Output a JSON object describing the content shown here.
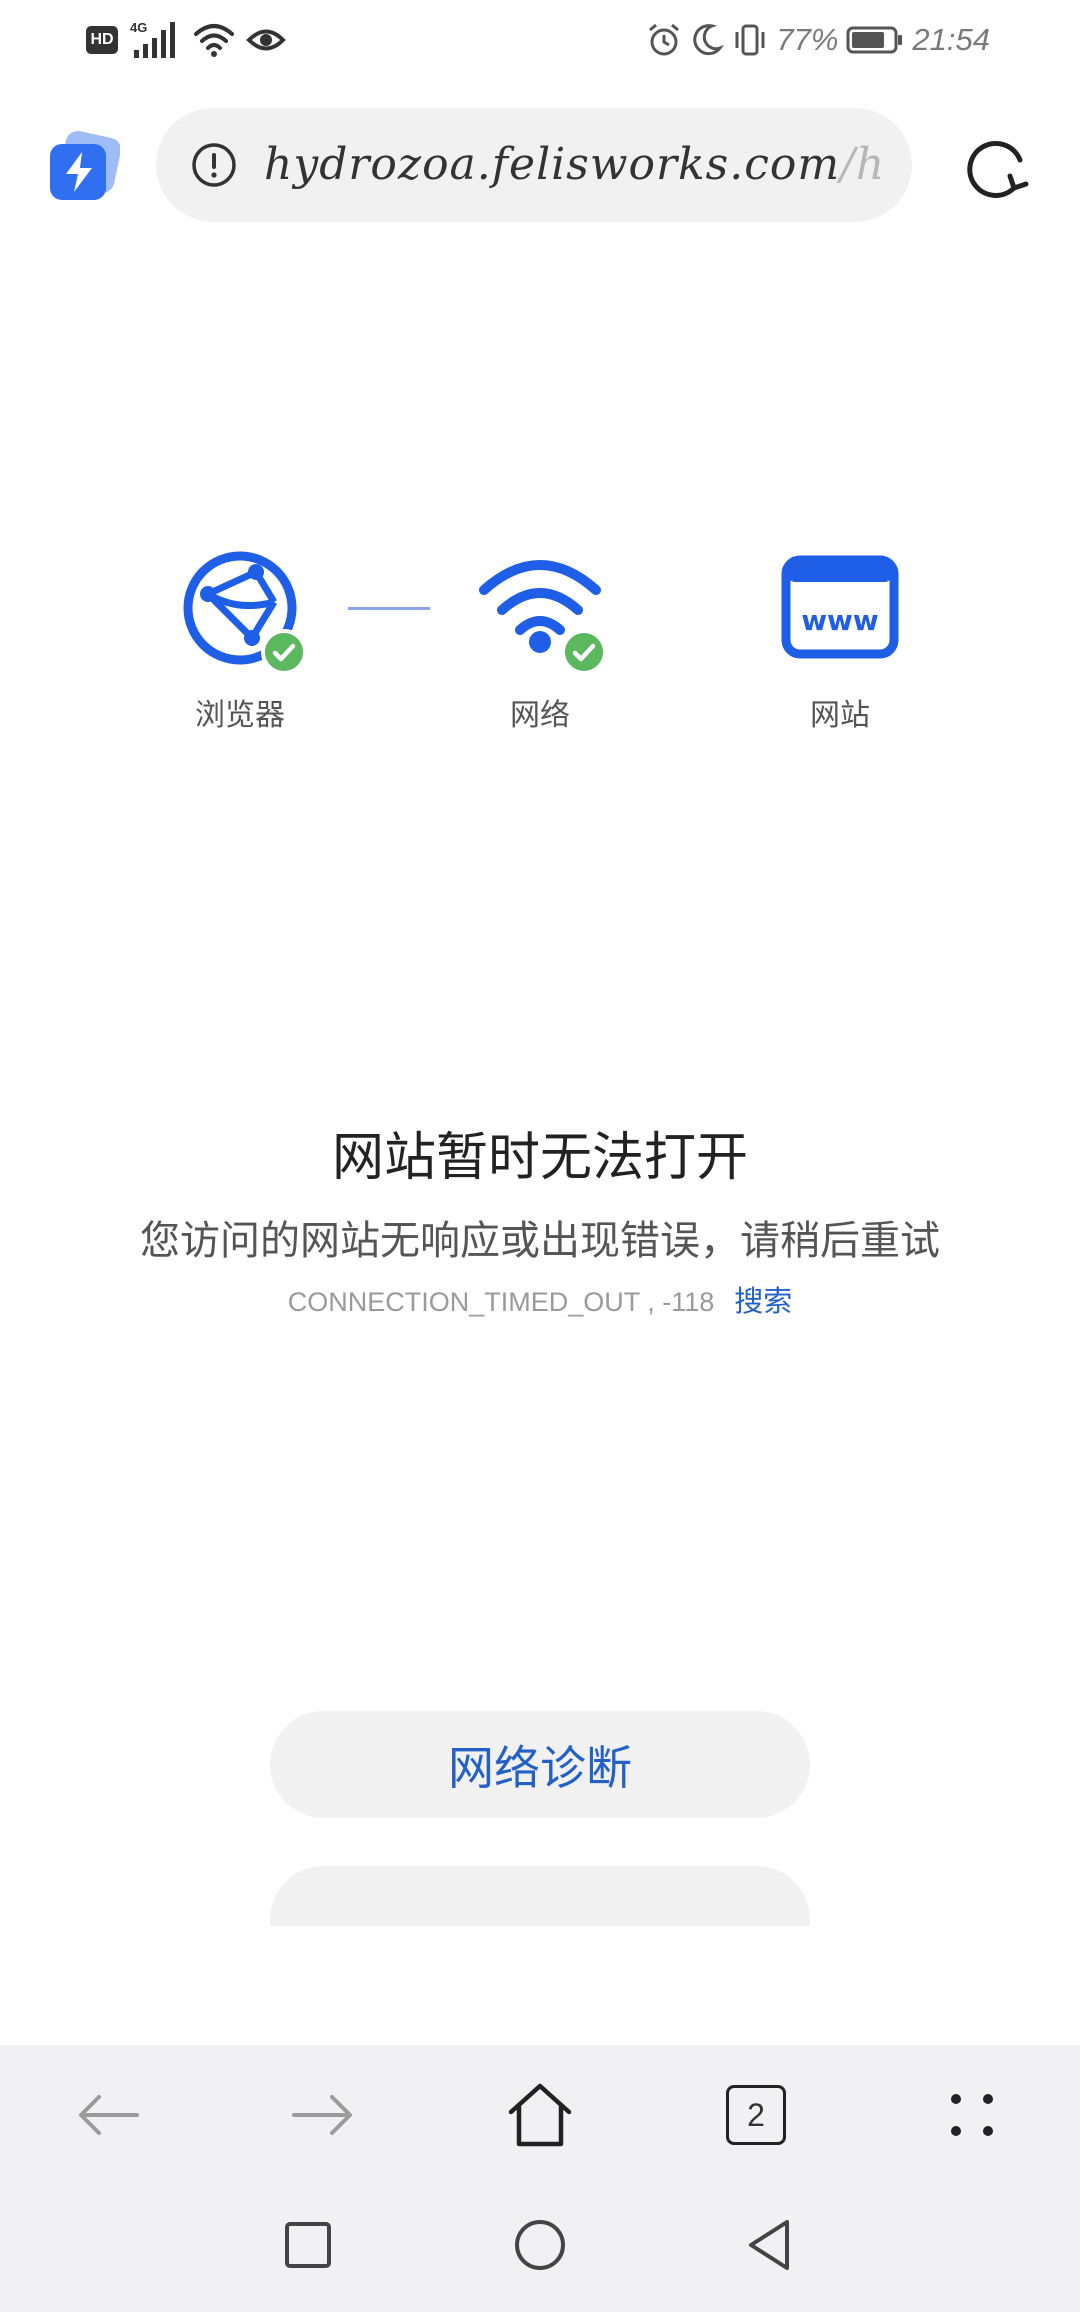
{
  "status_bar": {
    "hd_label": "HD",
    "network_label": "4G",
    "battery_percent": "77%",
    "time": "21:54"
  },
  "address_bar": {
    "url_host": "hydrozoa.felisworks.com",
    "url_path": "/hhzl/",
    "info_icon": "info-circle-icon",
    "reload_icon": "reload-icon"
  },
  "diagnostics": [
    {
      "label": "浏览器",
      "icon": "browser-globe-icon",
      "ok": true
    },
    {
      "label": "网络",
      "icon": "wifi-icon",
      "ok": true
    },
    {
      "label": "网站",
      "icon": "website-www-icon",
      "ok": false
    }
  ],
  "error": {
    "title": "网站暂时无法打开",
    "description": "您访问的网站无响应或出现错误，请稍后重试",
    "code": "CONNECTION_TIMED_OUT , -118",
    "search_link": "搜索"
  },
  "buttons": {
    "diagnose": "网络诊断"
  },
  "toolbar": {
    "tab_count": "2"
  },
  "colors": {
    "accent": "#2361c8",
    "icon_blue": "#1f5ee6",
    "success_green": "#5bb85f"
  }
}
